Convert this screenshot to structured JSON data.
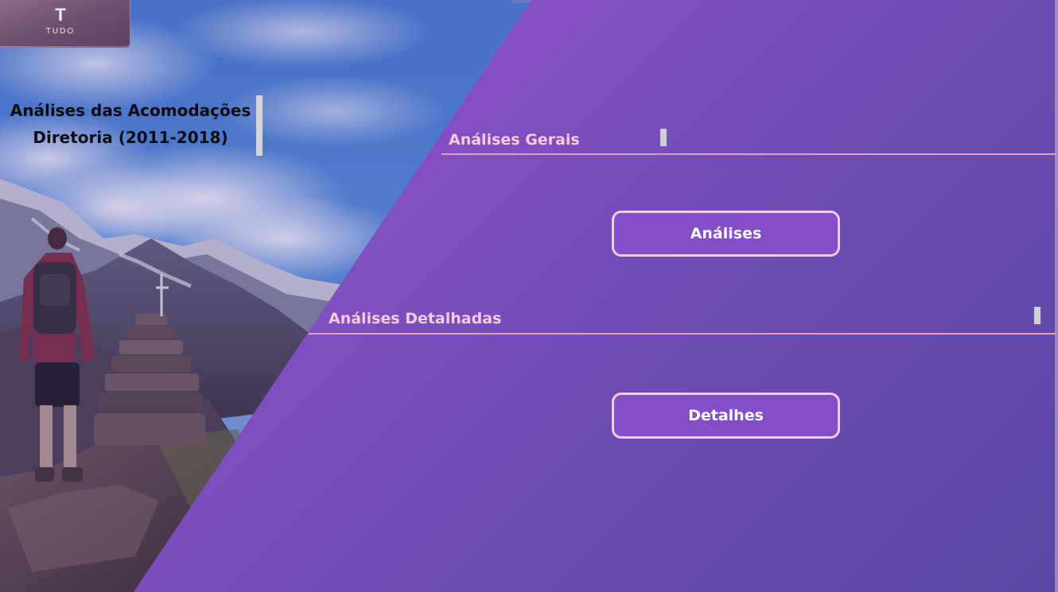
{
  "brand": {
    "logo_letter": "T",
    "logo_word": "TUDO"
  },
  "report": {
    "title_line1": "Análises das Acomodações",
    "title_line2": "Diretoria (2011-2018)"
  },
  "sections": {
    "general": {
      "title": "Análises Gerais",
      "button_label": "Análises"
    },
    "detailed": {
      "title": "Análises Detalhadas",
      "button_label": "Detalhes"
    }
  },
  "colors": {
    "panel_start": "#9a55cc",
    "panel_end": "#5a47a4",
    "section_text": "#f6cbe0",
    "section_rule": "#e89cc0",
    "button_fill": "#844ec8",
    "button_border": "#f0cde1"
  },
  "icons": {
    "hero_image": "hiker-mountain-photo"
  }
}
